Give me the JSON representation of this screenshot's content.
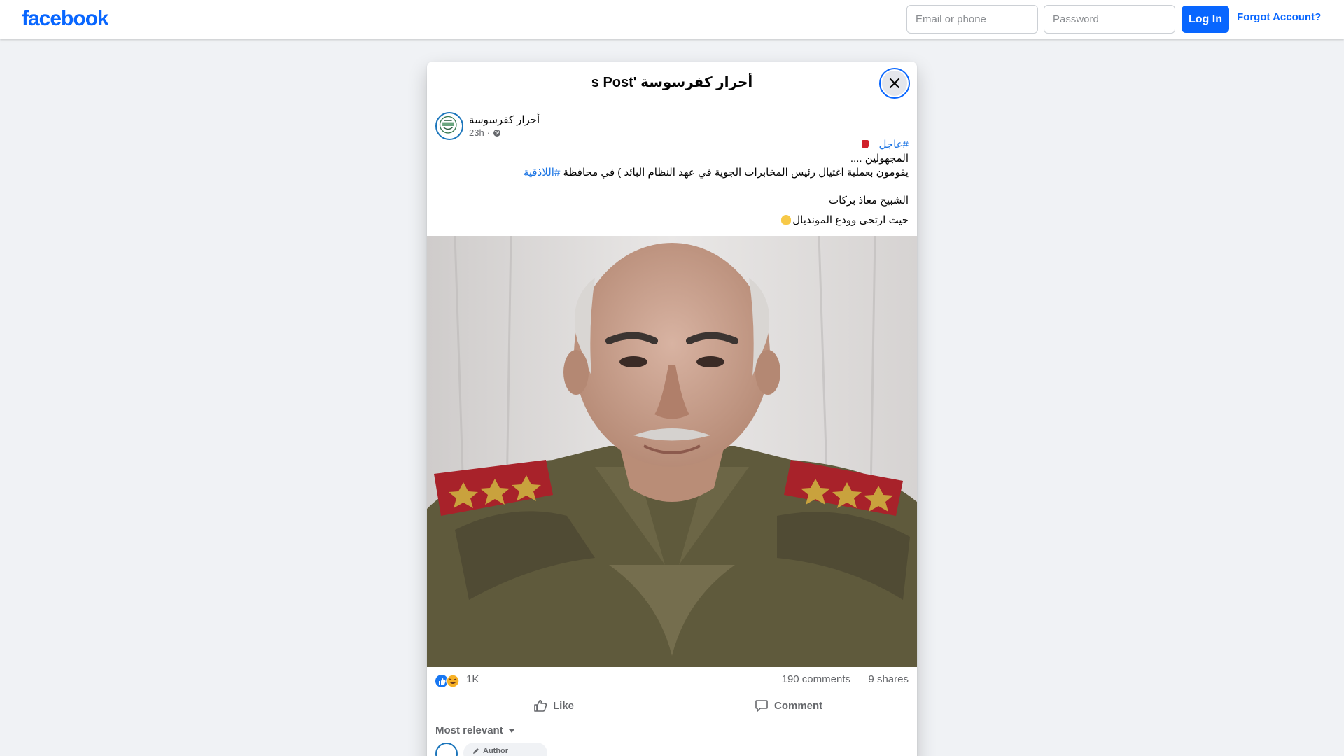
{
  "header": {
    "logo": "facebook",
    "email_placeholder": "Email or phone",
    "password_placeholder": "Password",
    "login_label": "Log In",
    "forgot_label": "Forgot Account?"
  },
  "dialog": {
    "title": "أحرار كفرسوسة 's Post",
    "close_icon": "close-icon"
  },
  "post": {
    "author": "أحرار كفرسوسة",
    "time": "23h",
    "privacy_icon": "globe-icon",
    "hashtag_urgent": "#عاجل",
    "line1": "المجهولين ....",
    "line2_text": "يقومون بعملية اغتيال رئيس المخابرات الجوية في عهد النظام البائد ) في محافظة ",
    "line2_hashtag": "#اللاذقية",
    "line3": "الشبيح معاذ بركات",
    "line4": "حيث ارتخى وودع الموندیال",
    "image_alt": "portrait photo",
    "reaction_count": "1K",
    "comments": "190 comments",
    "shares": "9 shares",
    "like_label": "Like",
    "comment_label": "Comment",
    "sort_label": "Most relevant",
    "author_badge": "Author"
  },
  "colors": {
    "brand": "#0866ff",
    "background": "#f0f2f5",
    "link": "#1b74e4"
  }
}
